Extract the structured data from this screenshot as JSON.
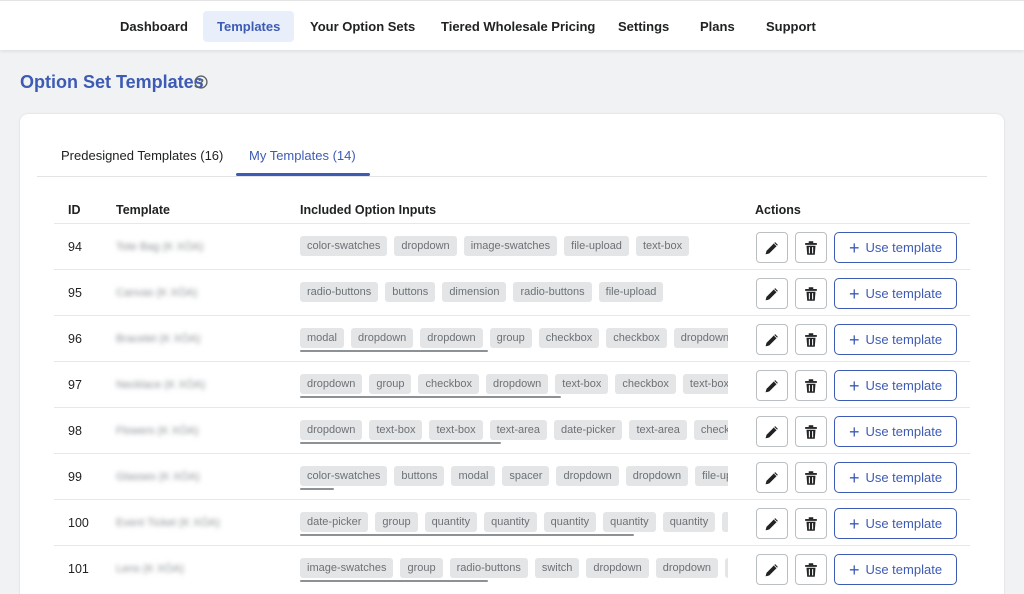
{
  "nav": [
    {
      "label": "Dashboard",
      "active": false
    },
    {
      "label": "Templates",
      "active": true
    },
    {
      "label": "Your Option Sets",
      "active": false
    },
    {
      "label": "Tiered Wholesale Pricing",
      "active": false
    },
    {
      "label": "Settings",
      "active": false
    },
    {
      "label": "Plans",
      "active": false
    },
    {
      "label": "Support",
      "active": false
    }
  ],
  "page_title": "Option Set Templates",
  "tabs": [
    {
      "label": "Predesigned Templates (16)",
      "active": false
    },
    {
      "label": "My Templates (14)",
      "active": true
    }
  ],
  "table": {
    "headers": [
      "ID",
      "Template",
      "Included Option Inputs",
      "Actions"
    ],
    "use_label": "Use template",
    "rows": [
      {
        "id": "94",
        "name": "Tote Bag (K XÓA)",
        "inputs": [
          "color-swatches",
          "dropdown",
          "image-swatches",
          "file-upload",
          "text-box"
        ],
        "scroll": 0
      },
      {
        "id": "95",
        "name": "Canvas (K XÓA)",
        "inputs": [
          "radio-buttons",
          "buttons",
          "dimension",
          "radio-buttons",
          "file-upload"
        ],
        "scroll": 0
      },
      {
        "id": "96",
        "name": "Bracelet (K XÓA)",
        "inputs": [
          "modal",
          "dropdown",
          "dropdown",
          "group",
          "checkbox",
          "checkbox",
          "dropdown"
        ],
        "scroll": 0.44
      },
      {
        "id": "97",
        "name": "Necklace (K XÓA)",
        "inputs": [
          "dropdown",
          "group",
          "checkbox",
          "dropdown",
          "text-box",
          "checkbox",
          "text-box"
        ],
        "scroll": 0.61
      },
      {
        "id": "98",
        "name": "Flowers (K XÓA)",
        "inputs": [
          "dropdown",
          "text-box",
          "text-box",
          "text-area",
          "date-picker",
          "text-area",
          "checkbox"
        ],
        "scroll": 0.47
      },
      {
        "id": "99",
        "name": "Glasses (K XÓA)",
        "inputs": [
          "color-swatches",
          "buttons",
          "modal",
          "spacer",
          "dropdown",
          "dropdown",
          "file-upload"
        ],
        "scroll": 0.08
      },
      {
        "id": "100",
        "name": "Event Ticket (K XÓA)",
        "inputs": [
          "date-picker",
          "group",
          "quantity",
          "quantity",
          "quantity",
          "quantity",
          "quantity",
          "quantity"
        ],
        "scroll": 0.78
      },
      {
        "id": "101",
        "name": "Lens (K XÓA)",
        "inputs": [
          "image-swatches",
          "group",
          "radio-buttons",
          "switch",
          "dropdown",
          "dropdown",
          "dropdown"
        ],
        "scroll": 0.44
      }
    ]
  },
  "icons": {
    "help": "help-circle-icon",
    "edit": "pencil-icon",
    "delete": "trash-icon",
    "add": "plus-icon"
  },
  "colors": {
    "accent": "#3d5bb4",
    "tag_bg": "#e4e5e7",
    "tag_text": "#6d7175",
    "page_bg": "#f1f2f4"
  }
}
